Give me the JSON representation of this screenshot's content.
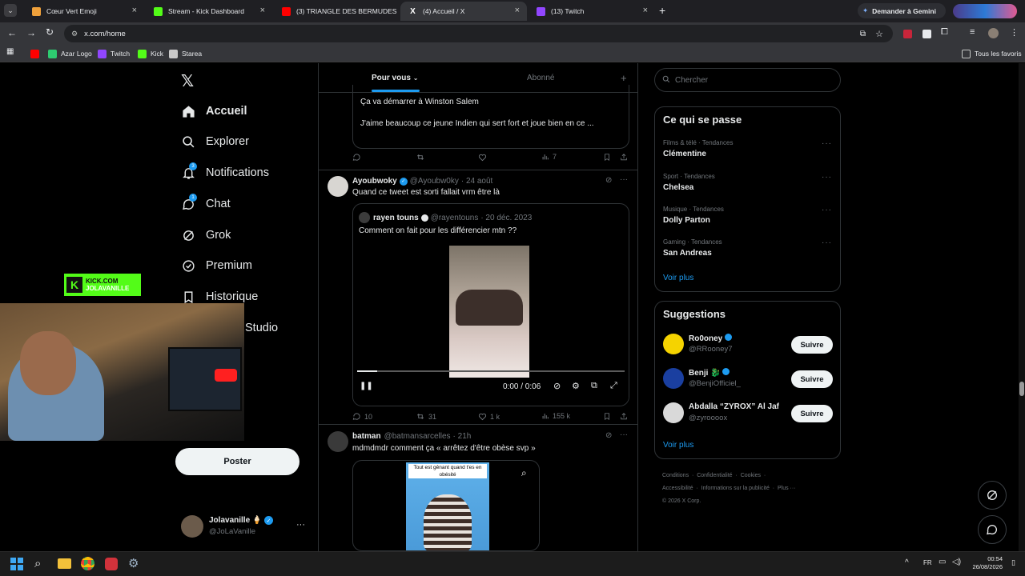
{
  "browser": {
    "tabs": [
      {
        "title": "Cœur Vert Emoji",
        "color": "#f0a13b"
      },
      {
        "title": "Stream - Kick Dashboard",
        "color": "#53fc18"
      },
      {
        "title": "(3) TRIANGLE DES BERMUDES",
        "color": "#ff0000"
      },
      {
        "title": "(4) Accueil / X",
        "color": "#ffffff"
      },
      {
        "title": "(13) Twitch",
        "color": "#9146ff"
      }
    ],
    "gemini": "Demander à Gemini",
    "url": "x.com/home",
    "bookmarks": [
      "Azar Logo",
      "Twitch",
      "Kick",
      "Starea"
    ],
    "all_bookmarks": "Tous les favoris"
  },
  "left_nav": {
    "items": [
      {
        "label": "Accueil"
      },
      {
        "label": "Explorer"
      },
      {
        "label": "Notifications",
        "badge": "3"
      },
      {
        "label": "Chat",
        "badge": "1"
      },
      {
        "label": "Grok"
      },
      {
        "label": "Premium"
      },
      {
        "label": "Historique"
      },
      {
        "label": "Studio"
      }
    ],
    "post_button": "Poster",
    "account": {
      "name": "Jolavanille 🍦",
      "handle": "@JoLaVanille"
    }
  },
  "overlay": {
    "kick_line1": "KICK.COM",
    "kick_line2": "JOLAVANILLE"
  },
  "feed": {
    "tabs": {
      "for_you": "Pour vous",
      "following": "Abonné"
    },
    "tweet0": {
      "line1": "Ça va démarrer à Winston Salem",
      "line2": "J'aime beaucoup ce jeune Indien qui sert fort et joue bien en ce ...",
      "views": "7"
    },
    "tweet1": {
      "name": "Ayoubwoky",
      "handle": "@Ayoubw0ky",
      "date": "· 24 août",
      "text": "Quand ce tweet est sorti fallait vrm être là",
      "quote": {
        "name": "rayen touns",
        "handle": "@rayentouns",
        "date": "· 20 déc. 2023",
        "text": "Comment on fait pour les différencier mtn ??"
      },
      "video_time": "0:00 / 0:06",
      "replies": "10",
      "reposts": "31",
      "likes": "1 k",
      "views": "155 k"
    },
    "tweet2": {
      "name": "batman",
      "handle": "@batmansarcelles",
      "date": "· 21h",
      "text": "mdmdmdr comment ça « arrêtez d'être obèse svp »",
      "media_caption": "Tout est gênant quand t'es en obésité"
    }
  },
  "sidebar": {
    "search_placeholder": "Chercher",
    "trends_title": "Ce qui se passe",
    "trends": [
      {
        "cat": "Films & télé · Tendances",
        "name": "Clémentine"
      },
      {
        "cat": "Sport · Tendances",
        "name": "Chelsea"
      },
      {
        "cat": "Musique · Tendances",
        "name": "Dolly Parton"
      },
      {
        "cat": "Gaming · Tendances",
        "name": "San Andreas"
      }
    ],
    "see_more": "Voir plus",
    "suggestions_title": "Suggestions",
    "suggestions": [
      {
        "name": "Ro0oney",
        "handle": "@RRooney7",
        "follow": "Suivre",
        "color": "#f5d300"
      },
      {
        "name": "Benji 🐉",
        "handle": "@BenjiOfficiel_",
        "follow": "Suivre",
        "color": "#1a3fa0"
      },
      {
        "name": "Abdalla “ZYROX” Al Jaf",
        "handle": "@zyroooox",
        "follow": "Suivre",
        "color": "#d9d9d9"
      }
    ],
    "footer": [
      "Conditions",
      "Confidentialité",
      "Cookies",
      "Accessibilité",
      "Informations sur la publicité",
      "Plus ···",
      "© 2026 X Corp."
    ]
  },
  "taskbar": {
    "time": "00:54",
    "date": "26/08/2026"
  }
}
